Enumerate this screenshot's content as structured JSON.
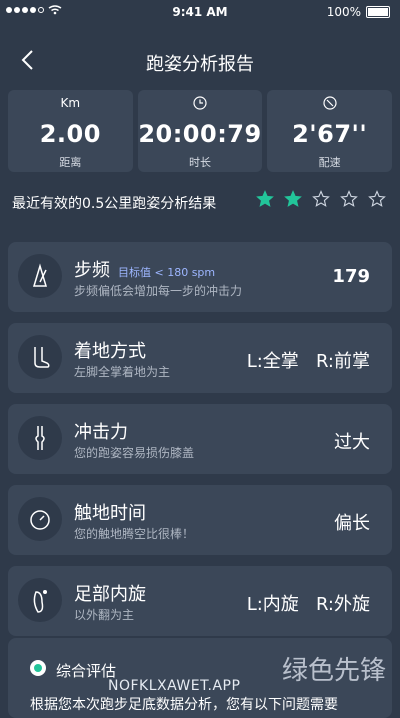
{
  "status_bar": {
    "time": "9:41 AM",
    "battery": "100%"
  },
  "header": {
    "title": "跑姿分析报告"
  },
  "stats": [
    {
      "unit": "Km",
      "value": "2.00",
      "label": "距离"
    },
    {
      "unit": "",
      "value": "20:00:79",
      "label": "时长"
    },
    {
      "unit": "",
      "value": "2'67''",
      "label": "配速"
    }
  ],
  "summary": {
    "text": "最近有效的0.5公里跑姿分析结果",
    "rating": 2,
    "max_rating": 5,
    "star_color": "#22c59a"
  },
  "metrics": [
    {
      "name": "步频",
      "target": "目标值 < 180 spm",
      "desc": "步频偏低会增加每一步的冲击力",
      "value": "179",
      "icon": "metronome-icon"
    },
    {
      "name": "着地方式",
      "desc": "左脚全掌着地为主",
      "value": "L:全掌   R:前掌",
      "icon": "foot-icon"
    },
    {
      "name": "冲击力",
      "desc": "您的跑姿容易损伤膝盖",
      "value": "过大",
      "icon": "knee-icon"
    },
    {
      "name": "触地时间",
      "desc": "您的触地腾空比很棒！",
      "value": "偏长",
      "icon": "timer-icon"
    },
    {
      "name": "足部内旋",
      "desc": "以外翻为主",
      "value": "L:内旋   R:外旋",
      "icon": "footprint-icon"
    }
  ],
  "evaluation": {
    "label": "综合评估",
    "desc": "根据您本次跑步足底数据分析，您有以下问题需要"
  },
  "watermark": {
    "text": "NOFKLXAWET.APP",
    "logo_text": "绿色先锋"
  }
}
